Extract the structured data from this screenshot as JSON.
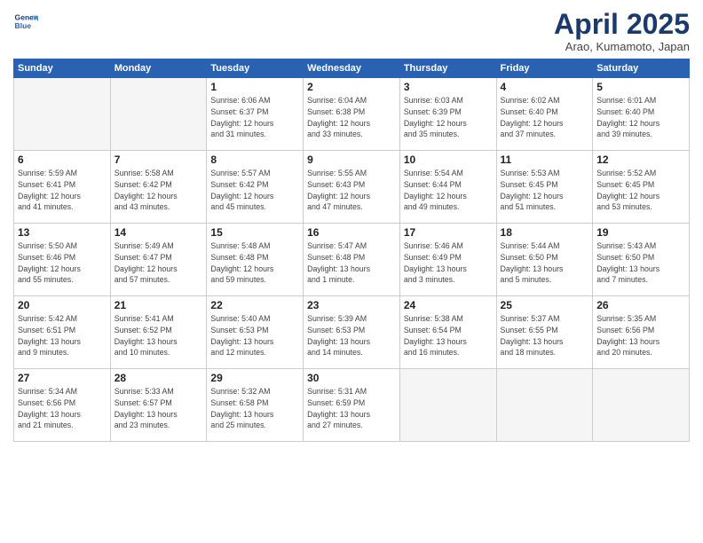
{
  "header": {
    "logo_line1": "General",
    "logo_line2": "Blue",
    "title": "April 2025",
    "subtitle": "Arao, Kumamoto, Japan"
  },
  "weekdays": [
    "Sunday",
    "Monday",
    "Tuesday",
    "Wednesday",
    "Thursday",
    "Friday",
    "Saturday"
  ],
  "weeks": [
    [
      {
        "day": "",
        "info": ""
      },
      {
        "day": "",
        "info": ""
      },
      {
        "day": "1",
        "info": "Sunrise: 6:06 AM\nSunset: 6:37 PM\nDaylight: 12 hours\nand 31 minutes."
      },
      {
        "day": "2",
        "info": "Sunrise: 6:04 AM\nSunset: 6:38 PM\nDaylight: 12 hours\nand 33 minutes."
      },
      {
        "day": "3",
        "info": "Sunrise: 6:03 AM\nSunset: 6:39 PM\nDaylight: 12 hours\nand 35 minutes."
      },
      {
        "day": "4",
        "info": "Sunrise: 6:02 AM\nSunset: 6:40 PM\nDaylight: 12 hours\nand 37 minutes."
      },
      {
        "day": "5",
        "info": "Sunrise: 6:01 AM\nSunset: 6:40 PM\nDaylight: 12 hours\nand 39 minutes."
      }
    ],
    [
      {
        "day": "6",
        "info": "Sunrise: 5:59 AM\nSunset: 6:41 PM\nDaylight: 12 hours\nand 41 minutes."
      },
      {
        "day": "7",
        "info": "Sunrise: 5:58 AM\nSunset: 6:42 PM\nDaylight: 12 hours\nand 43 minutes."
      },
      {
        "day": "8",
        "info": "Sunrise: 5:57 AM\nSunset: 6:42 PM\nDaylight: 12 hours\nand 45 minutes."
      },
      {
        "day": "9",
        "info": "Sunrise: 5:55 AM\nSunset: 6:43 PM\nDaylight: 12 hours\nand 47 minutes."
      },
      {
        "day": "10",
        "info": "Sunrise: 5:54 AM\nSunset: 6:44 PM\nDaylight: 12 hours\nand 49 minutes."
      },
      {
        "day": "11",
        "info": "Sunrise: 5:53 AM\nSunset: 6:45 PM\nDaylight: 12 hours\nand 51 minutes."
      },
      {
        "day": "12",
        "info": "Sunrise: 5:52 AM\nSunset: 6:45 PM\nDaylight: 12 hours\nand 53 minutes."
      }
    ],
    [
      {
        "day": "13",
        "info": "Sunrise: 5:50 AM\nSunset: 6:46 PM\nDaylight: 12 hours\nand 55 minutes."
      },
      {
        "day": "14",
        "info": "Sunrise: 5:49 AM\nSunset: 6:47 PM\nDaylight: 12 hours\nand 57 minutes."
      },
      {
        "day": "15",
        "info": "Sunrise: 5:48 AM\nSunset: 6:48 PM\nDaylight: 12 hours\nand 59 minutes."
      },
      {
        "day": "16",
        "info": "Sunrise: 5:47 AM\nSunset: 6:48 PM\nDaylight: 13 hours\nand 1 minute."
      },
      {
        "day": "17",
        "info": "Sunrise: 5:46 AM\nSunset: 6:49 PM\nDaylight: 13 hours\nand 3 minutes."
      },
      {
        "day": "18",
        "info": "Sunrise: 5:44 AM\nSunset: 6:50 PM\nDaylight: 13 hours\nand 5 minutes."
      },
      {
        "day": "19",
        "info": "Sunrise: 5:43 AM\nSunset: 6:50 PM\nDaylight: 13 hours\nand 7 minutes."
      }
    ],
    [
      {
        "day": "20",
        "info": "Sunrise: 5:42 AM\nSunset: 6:51 PM\nDaylight: 13 hours\nand 9 minutes."
      },
      {
        "day": "21",
        "info": "Sunrise: 5:41 AM\nSunset: 6:52 PM\nDaylight: 13 hours\nand 10 minutes."
      },
      {
        "day": "22",
        "info": "Sunrise: 5:40 AM\nSunset: 6:53 PM\nDaylight: 13 hours\nand 12 minutes."
      },
      {
        "day": "23",
        "info": "Sunrise: 5:39 AM\nSunset: 6:53 PM\nDaylight: 13 hours\nand 14 minutes."
      },
      {
        "day": "24",
        "info": "Sunrise: 5:38 AM\nSunset: 6:54 PM\nDaylight: 13 hours\nand 16 minutes."
      },
      {
        "day": "25",
        "info": "Sunrise: 5:37 AM\nSunset: 6:55 PM\nDaylight: 13 hours\nand 18 minutes."
      },
      {
        "day": "26",
        "info": "Sunrise: 5:35 AM\nSunset: 6:56 PM\nDaylight: 13 hours\nand 20 minutes."
      }
    ],
    [
      {
        "day": "27",
        "info": "Sunrise: 5:34 AM\nSunset: 6:56 PM\nDaylight: 13 hours\nand 21 minutes."
      },
      {
        "day": "28",
        "info": "Sunrise: 5:33 AM\nSunset: 6:57 PM\nDaylight: 13 hours\nand 23 minutes."
      },
      {
        "day": "29",
        "info": "Sunrise: 5:32 AM\nSunset: 6:58 PM\nDaylight: 13 hours\nand 25 minutes."
      },
      {
        "day": "30",
        "info": "Sunrise: 5:31 AM\nSunset: 6:59 PM\nDaylight: 13 hours\nand 27 minutes."
      },
      {
        "day": "",
        "info": ""
      },
      {
        "day": "",
        "info": ""
      },
      {
        "day": "",
        "info": ""
      }
    ]
  ]
}
